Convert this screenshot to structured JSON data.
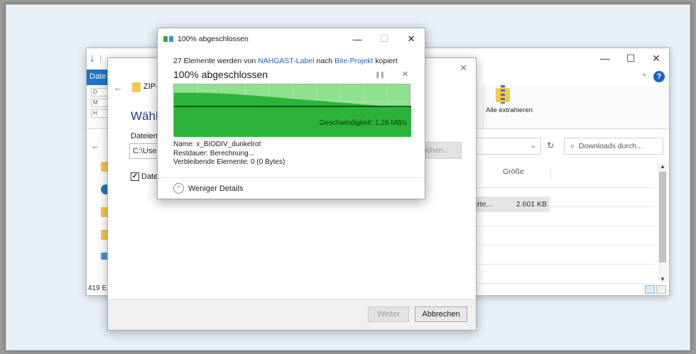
{
  "explorer": {
    "tab_datei": "Date",
    "ribbon_mini": [
      "D",
      "M",
      "H"
    ],
    "extract_all_label": "Alle extrahieren",
    "search_placeholder": "Downloads durch...",
    "column_size": "Größe",
    "selected_row": {
      "name": "ierte...",
      "size": "2.601 KB"
    },
    "status_text": "419 E"
  },
  "wizard": {
    "title": "ZIP-K",
    "heading": "Wähle",
    "field_label": "Dateien v",
    "path_value": "C:\\User",
    "browse_label": "uchen...",
    "checkbox_label": "Datei",
    "checkbox_checked": true,
    "next_button": "Weiter",
    "cancel_button": "Abbrechen"
  },
  "copy_dialog": {
    "title": "100% abgeschlossen",
    "desc_prefix": "27 Elemente werden von",
    "source": "NAHGAST-Label",
    "desc_middle": "nach",
    "destination": "Bite-Projekt",
    "desc_suffix": "kopiert",
    "headline": "100% abgeschlossen",
    "speed_text": "Geschwindigkeit: 1,28 MB/s",
    "name_line": "Name: x_BIODIV_dunkelrot",
    "remaining_time_line": "Restdauer: Berechnung...",
    "remaining_items_line": "Verbleibende Elemente: 0 (0 Bytes)",
    "less_details": "Weniger Details",
    "progress": 1.0,
    "speed_trend": [
      1.85,
      1.85,
      1.8,
      1.7,
      1.6,
      1.5,
      1.4,
      1.3,
      1.28
    ]
  }
}
